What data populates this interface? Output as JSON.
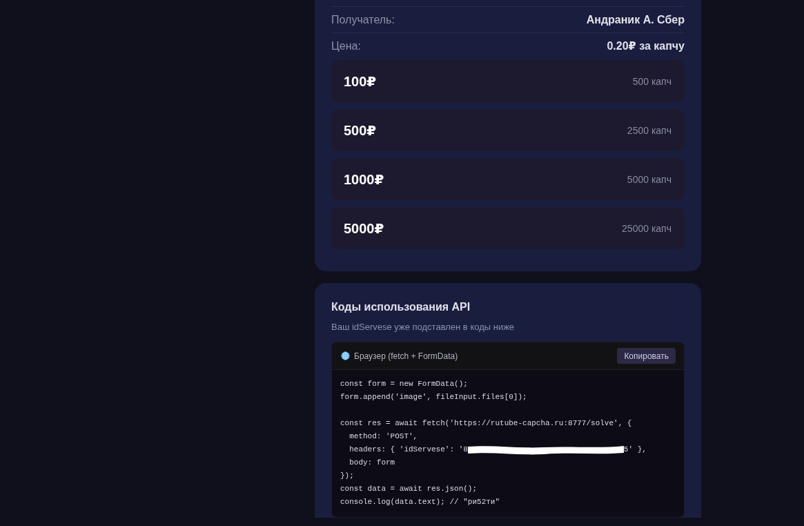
{
  "payment_card": {
    "details": [
      {
        "label": "Получатель:",
        "value": "Андраник А. Сбер"
      },
      {
        "label": "Цена:",
        "value": "0.20₽ за капчу"
      }
    ],
    "packages": [
      {
        "price": "100₽",
        "captchas": "500 капч"
      },
      {
        "price": "500₽",
        "captchas": "2500 капч"
      },
      {
        "price": "1000₽",
        "captchas": "5000 капч"
      },
      {
        "price": "5000₽",
        "captchas": "25000 капч"
      }
    ]
  },
  "api_card": {
    "title": "Коды использования API",
    "subtitle": "Ваш idServese уже подставлен в коды ниже",
    "code_block": {
      "label": "Браузер (fetch + FormData)",
      "copy_button": "Копировать",
      "lines": [
        {
          "kind": "code",
          "text": "const form = new FormData();"
        },
        {
          "kind": "code",
          "text": "form.append('image', fileInput.files[0]);"
        },
        {
          "kind": "blank"
        },
        {
          "kind": "code",
          "text": "const res = await fetch('https://rutube-capcha.ru:8777/solve', {"
        },
        {
          "kind": "code",
          "text": "  method: 'POST',"
        },
        {
          "kind": "redacted",
          "before": "  headers: { 'idServese': '8",
          "after": "5' },"
        },
        {
          "kind": "code",
          "text": "  body: form"
        },
        {
          "kind": "code",
          "text": "});"
        },
        {
          "kind": "code",
          "text": "const data = await res.json();"
        },
        {
          "kind": "code",
          "text": "console.log(data.text); // \"ри52ти\""
        }
      ]
    }
  }
}
